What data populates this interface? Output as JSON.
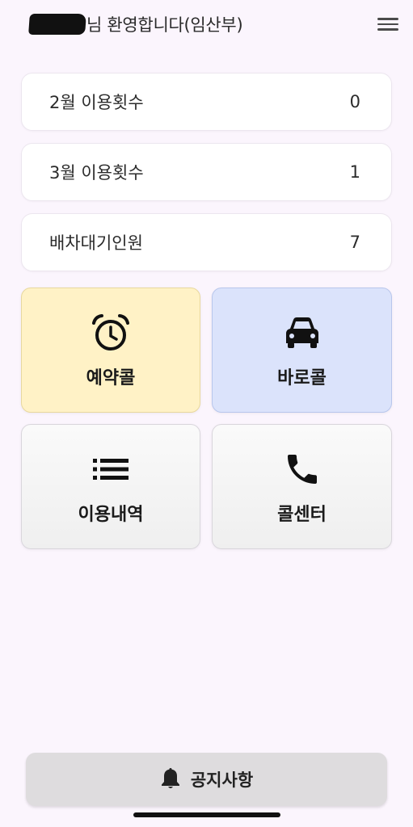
{
  "header": {
    "greeting": "님 환영합니다(임산부)",
    "menu_icon": "hamburger-menu-icon"
  },
  "stats": [
    {
      "label": "2월 이용횟수",
      "value": "0"
    },
    {
      "label": "3월 이용횟수",
      "value": "1"
    },
    {
      "label": "배차대기인원",
      "value": "7"
    }
  ],
  "tiles": [
    {
      "label": "예약콜",
      "icon": "alarm-clock-icon",
      "color": "#fff2c6"
    },
    {
      "label": "바로콜",
      "icon": "car-icon",
      "color": "#dbe3fb"
    },
    {
      "label": "이용내역",
      "icon": "list-icon",
      "color": "#f4f4f4"
    },
    {
      "label": "콜센터",
      "icon": "phone-icon",
      "color": "#f4f4f4"
    }
  ],
  "notice": {
    "label": "공지사항",
    "icon": "bell-icon"
  }
}
